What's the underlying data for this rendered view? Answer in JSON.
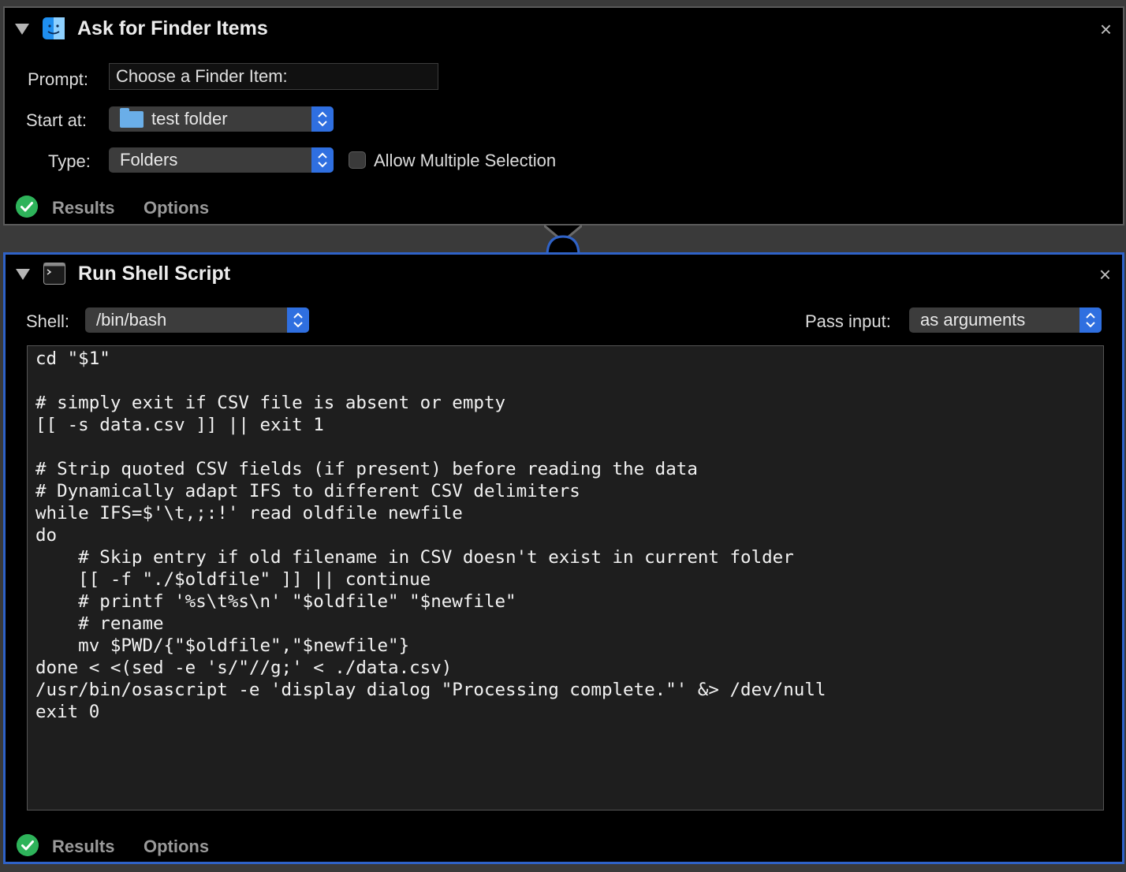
{
  "ask_for_finder_items": {
    "title": "Ask for Finder Items",
    "icon": "finder-icon",
    "prompt_label": "Prompt:",
    "prompt_value": "Choose a Finder Item:",
    "start_at_label": "Start at:",
    "start_at_value": "test folder",
    "type_label": "Type:",
    "type_value": "Folders",
    "allow_multiple_label": "Allow Multiple Selection",
    "allow_multiple_checked": false,
    "results_tab": "Results",
    "options_tab": "Options",
    "close_glyph": "×"
  },
  "run_shell_script": {
    "title": "Run Shell Script",
    "icon": "terminal-icon",
    "shell_label": "Shell:",
    "shell_value": "/bin/bash",
    "pass_input_label": "Pass input:",
    "pass_input_value": "as arguments",
    "script": "cd \"$1\"\n\n# simply exit if CSV file is absent or empty\n[[ -s data.csv ]] || exit 1\n\n# Strip quoted CSV fields (if present) before reading the data\n# Dynamically adapt IFS to different CSV delimiters\nwhile IFS=$'\\t,;:!' read oldfile newfile\ndo\n    # Skip entry if old filename in CSV doesn't exist in current folder\n    [[ -f \"./$oldfile\" ]] || continue\n    # printf '%s\\t%s\\n' \"$oldfile\" \"$newfile\"\n    # rename\n    mv $PWD/{\"$oldfile\",\"$newfile\"}\ndone < <(sed -e 's/\"//g;' < ./data.csv)\n/usr/bin/osascript -e 'display dialog \"Processing complete.\"' &> /dev/null\nexit 0",
    "results_tab": "Results",
    "options_tab": "Options",
    "close_glyph": "×"
  },
  "colors": {
    "accent": "#2f6fe0",
    "selection_border": "#2f62c7",
    "success": "#2eb35a",
    "panel_bg": "#000000"
  }
}
